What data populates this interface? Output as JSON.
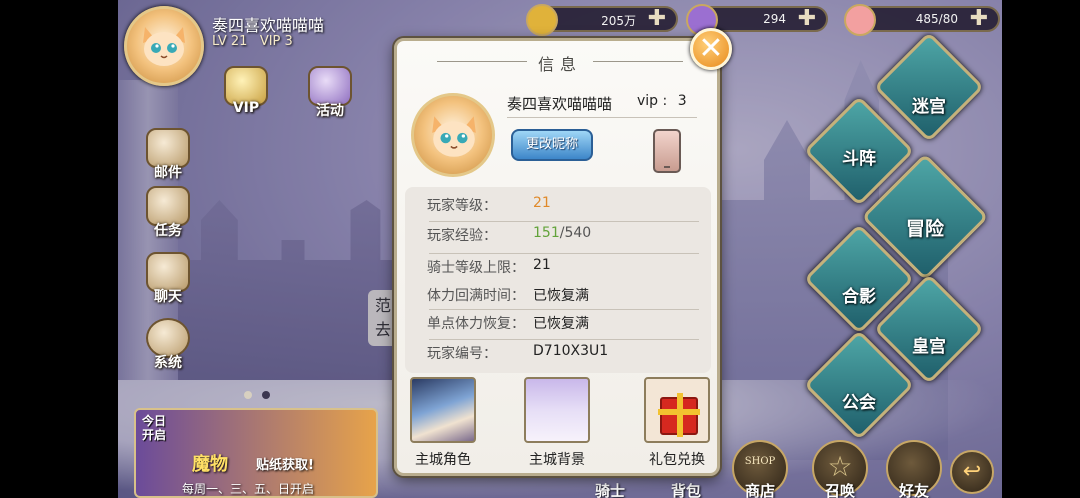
{
  "player": {
    "name": "奏四喜欢喵喵喵",
    "level_label": "LV",
    "level": "21",
    "vip_label": "VIP",
    "vip": "3"
  },
  "resources": [
    {
      "name": "gold",
      "value": "205万",
      "color": "#e0b23a"
    },
    {
      "name": "gem",
      "value": "294",
      "color": "#9b6fd1"
    },
    {
      "name": "stamina",
      "value": "485/80",
      "color": "#f2a0a0"
    }
  ],
  "side_menu": [
    {
      "label": "VIP"
    },
    {
      "label": "活动"
    },
    {
      "label": "邮件"
    },
    {
      "label": "任务"
    },
    {
      "label": "聊天"
    },
    {
      "label": "系统"
    }
  ],
  "right_menu": [
    {
      "label": "迷宫"
    },
    {
      "label": "斗阵"
    },
    {
      "label": "冒险"
    },
    {
      "label": "合影"
    },
    {
      "label": "皇宫"
    },
    {
      "label": "公会"
    }
  ],
  "bottom_bar": [
    {
      "label": "骑士"
    },
    {
      "label": "背包"
    },
    {
      "label": "商店"
    },
    {
      "label": "召唤"
    },
    {
      "label": "好友"
    }
  ],
  "bottom_shop_sign": "SHOP",
  "banner": {
    "line1": "今日开启",
    "title": "魔物",
    "subtitle": "贴纸获取!",
    "schedule": "每周一、三、五、日开启"
  },
  "background_text": {
    "line1": "范",
    "line2": "去"
  },
  "modal": {
    "title": "信息",
    "name": "奏四喜欢喵喵喵",
    "vip_label": "vip :",
    "vip_value": "3",
    "rename_button": "更改昵称",
    "rows": [
      {
        "key": "玩家等级：",
        "value": "21",
        "color": "#e08a2a"
      },
      {
        "key": "玩家经验：",
        "value": "",
        "exp_current": "151",
        "exp_total": "/540"
      },
      {
        "key": "骑士等级上限：",
        "value": "21"
      },
      {
        "key": "体力回满时间：",
        "value": "已恢复满"
      },
      {
        "key": "单点体力恢复：",
        "value": "已恢复满"
      },
      {
        "key": "玩家编号：",
        "value": "D710X3U1"
      }
    ],
    "bottom_items": [
      {
        "label": "主城角色"
      },
      {
        "label": "主城背景"
      },
      {
        "label": "礼包兑换"
      }
    ]
  },
  "colors": {
    "exp_green": "#62a33a",
    "level_orange": "#e08a2a"
  }
}
